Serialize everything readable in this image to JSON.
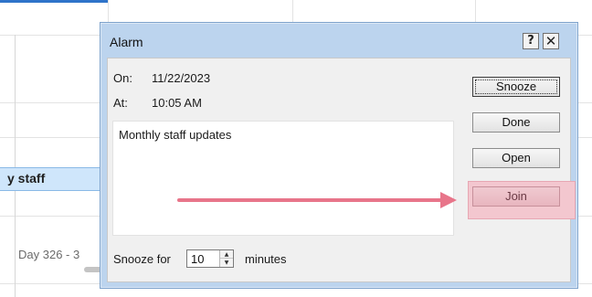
{
  "background": {
    "event_label": "y staff",
    "day_label": "Day 326 - 3"
  },
  "dialog": {
    "title": "Alarm",
    "help_button": "?",
    "close_button": "✕",
    "on_label": "On:",
    "on_value": "11/22/2023",
    "at_label": "At:",
    "at_value": "10:05 AM",
    "subject": "Monthly staff updates",
    "snooze_for_label": "Snooze for",
    "snooze_value": "10",
    "minutes_label": "minutes",
    "buttons": {
      "snooze": "Snooze",
      "done": "Done",
      "open": "Open",
      "join": "Join"
    }
  },
  "annotation": {
    "arrow_color": "#e8758a",
    "highlight_color": "#f3c7cf"
  },
  "icons": {
    "spin_up": "spin-up-icon",
    "spin_down": "spin-down-icon",
    "arrow": "annotation-arrow-icon"
  }
}
